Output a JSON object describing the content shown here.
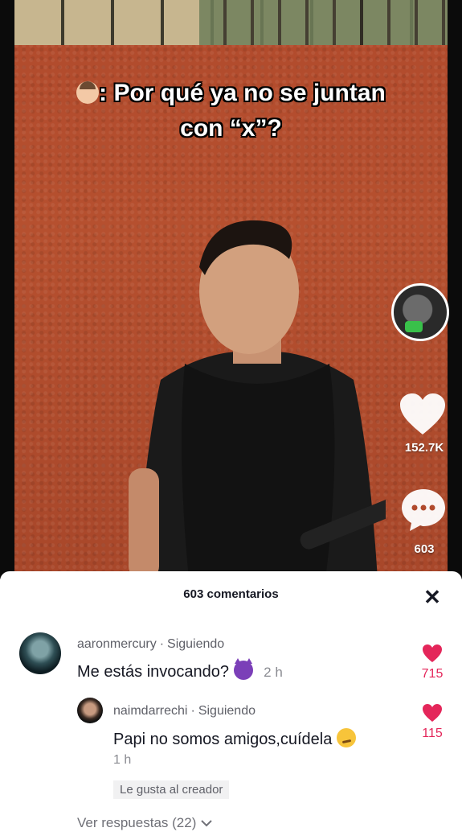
{
  "video": {
    "caption_line1": ": Por qué ya no se juntan",
    "caption_line2": "con “x”?",
    "caption_emoji": "man-face-emoji",
    "like_count": "152.7K",
    "comment_count": "603"
  },
  "comments_panel": {
    "title": "603 comentarios",
    "close_icon": "close-icon"
  },
  "comments": [
    {
      "username": "aaronmercury",
      "relation": "Siguiendo",
      "text": "Me estás invocando?",
      "emoji": "devil-emoji",
      "time": "2 h",
      "likes": "715"
    }
  ],
  "reply": {
    "username": "naimdarrechi",
    "relation": "Siguiendo",
    "text": "Papi no somos amigos,cuídela",
    "emoji": "smirk-emoji",
    "time": "1 h",
    "likes": "115",
    "badge": "Le gusta al creador"
  },
  "view_replies": "Ver respuestas (22)",
  "colors": {
    "like_red": "#e4265a",
    "text_dark": "#161823",
    "text_muted": "#8a8b91"
  }
}
